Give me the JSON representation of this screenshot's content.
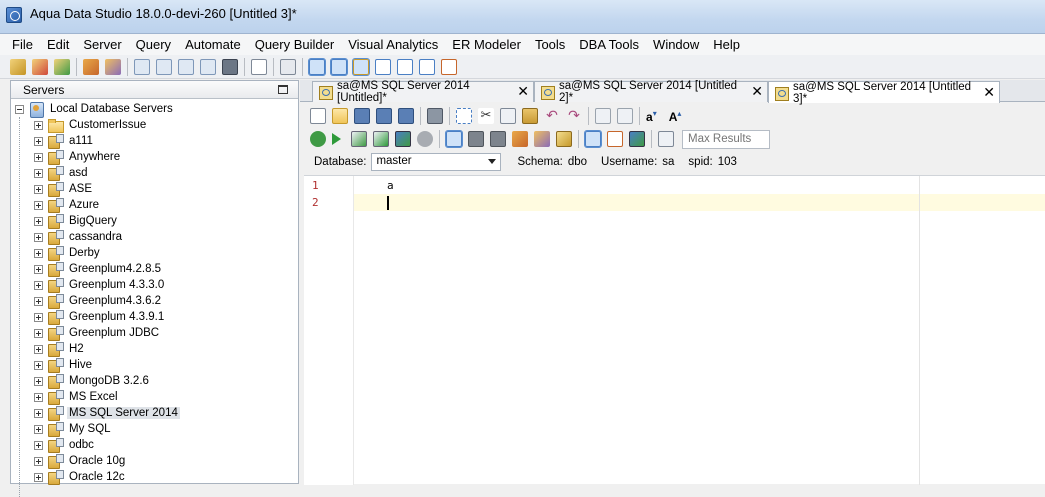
{
  "window": {
    "title": "Aqua Data Studio 18.0.0-devi-260 [Untitled 3]*"
  },
  "menu": [
    "File",
    "Edit",
    "Server",
    "Query",
    "Automate",
    "Query Builder",
    "Visual Analytics",
    "ER Modeler",
    "Tools",
    "DBA Tools",
    "Window",
    "Help"
  ],
  "main_toolbar": {
    "icons": [
      "register-server-icon",
      "unregister-server-icon",
      "connect-icon",
      "edit-server-icon",
      "server-properties-icon",
      "query-analyzer-icon",
      "schema-browser-icon",
      "find-icon",
      "compare-icon",
      "dba-icon",
      "new-file-icon",
      "scripts-icon",
      "layout-1-icon",
      "layout-2-icon",
      "layout-3-icon",
      "layout-4-icon",
      "layout-5-icon",
      "layout-6-icon",
      "layout-7-icon"
    ],
    "colors": {
      "primary": "#4a7fc4",
      "accent": "#e0a13a"
    }
  },
  "servers_panel": {
    "title": "Servers",
    "root": "Local Database Servers",
    "items": [
      "CustomerIssue",
      "a111",
      "Anywhere",
      "asd",
      "ASE",
      "Azure",
      "BigQuery",
      "cassandra",
      "Derby",
      "Greenplum4.2.8.5",
      "Greenplum 4.3.3.0",
      "Greenplum4.3.6.2",
      "Greenplum 4.3.9.1",
      "Greenplum JDBC",
      "H2",
      "Hive",
      "MongoDB 3.2.6",
      "MS Excel",
      "MS SQL Server 2014",
      "My SQL",
      "odbc",
      "Oracle 10g",
      "Oracle 12c"
    ],
    "selected": "MS SQL Server 2014"
  },
  "tabs": [
    {
      "label": "sa@MS SQL Server 2014 [Untitled]*",
      "close": "✕"
    },
    {
      "label": "sa@MS SQL Server 2014 [Untitled 2]*",
      "close": "✕"
    },
    {
      "label": "sa@MS SQL Server 2014 [Untitled 3]*",
      "close": "✕"
    }
  ],
  "query_toolbar": {
    "font_decrease": "a",
    "font_increase": "A",
    "max_results_placeholder": "Max Results"
  },
  "connection": {
    "database_label": "Database:",
    "database_value": "master",
    "schema_label": "Schema:",
    "schema_value": "dbo",
    "username_label": "Username:",
    "username_value": "sa",
    "spid_label": "spid:",
    "spid_value": "103"
  },
  "editor": {
    "lines": [
      {
        "number": "1",
        "text": "a"
      },
      {
        "number": "2",
        "text": ""
      }
    ]
  }
}
